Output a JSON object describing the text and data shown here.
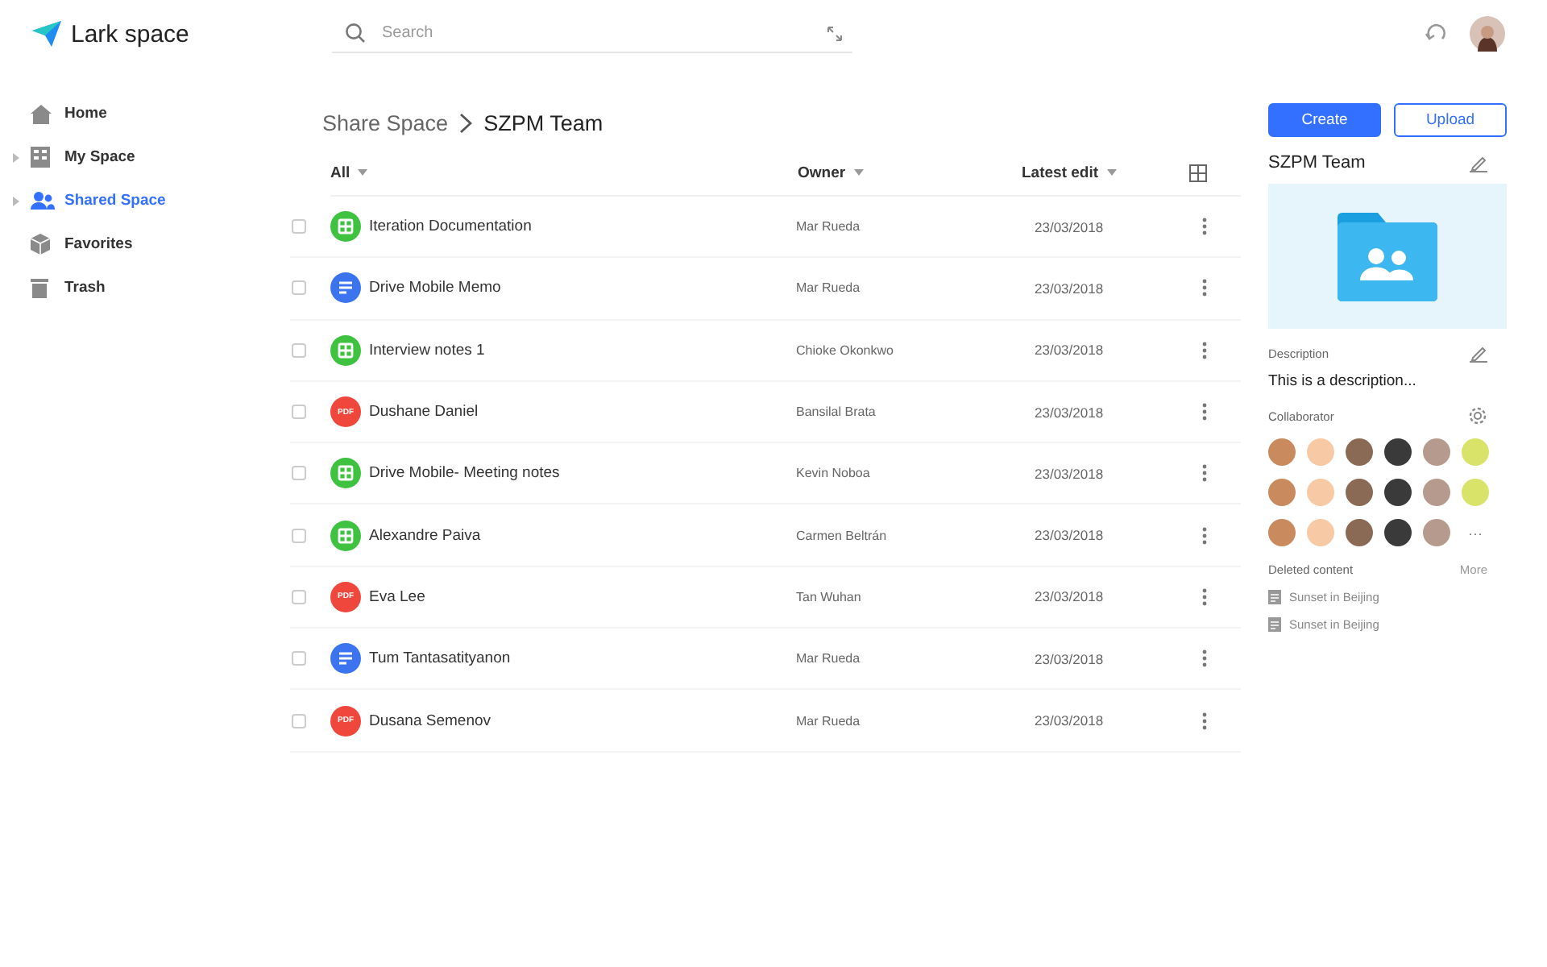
{
  "app": {
    "title": "Lark space"
  },
  "search": {
    "placeholder": "Search"
  },
  "sidebar": {
    "items": [
      {
        "label": "Home",
        "kind": "home",
        "collapsible": false,
        "selected": false
      },
      {
        "label": "My Space",
        "kind": "space",
        "collapsible": true,
        "selected": false
      },
      {
        "label": "Shared Space",
        "kind": "team",
        "collapsible": true,
        "selected": true
      },
      {
        "label": "Favorites",
        "kind": "favorites",
        "collapsible": false,
        "selected": false
      },
      {
        "label": "Trash",
        "kind": "trash",
        "collapsible": false,
        "selected": false
      }
    ]
  },
  "breadcrumb": [
    {
      "label": "Share Space",
      "selected": false
    },
    {
      "label": "SZPM Team",
      "selected": true
    }
  ],
  "table": {
    "columns": [
      "All",
      "Owner",
      "Latest edit"
    ],
    "rows": [
      {
        "kind": "sheet",
        "name": "Iteration Documentation",
        "owner": "Mar Rueda",
        "date": "23/03/2018",
        "checked": false
      },
      {
        "kind": "doc",
        "name": "Drive Mobile Memo",
        "owner": "Mar Rueda",
        "date": "23/03/2018",
        "checked": false
      },
      {
        "kind": "sheet",
        "name": "Interview notes 1",
        "owner": "Chioke Okonkwo",
        "date": "23/03/2018",
        "checked": false
      },
      {
        "kind": "pdf",
        "icon_text": "PDF",
        "name": "Dushane Daniel",
        "owner": "Bansilal Brata",
        "date": "23/03/2018",
        "checked": false
      },
      {
        "kind": "sheet",
        "name": "Drive Mobile- Meeting notes",
        "owner": "Kevin Noboa",
        "date": "23/03/2018",
        "checked": false
      },
      {
        "kind": "sheet",
        "name": "Alexandre Paiva",
        "owner": "Carmen Beltrán",
        "date": "23/03/2018",
        "checked": false
      },
      {
        "kind": "pdf",
        "icon_text": "PDF",
        "name": "Eva Lee",
        "owner": "Tan Wuhan",
        "date": "23/03/2018",
        "checked": false
      },
      {
        "kind": "doc",
        "name": "Tum Tantasatityanon",
        "owner": "Mar Rueda",
        "date": "23/03/2018",
        "checked": false
      },
      {
        "kind": "pdf",
        "icon_text": "PDF",
        "name": "Dusana Semenov",
        "owner": "Mar Rueda",
        "date": "23/03/2018",
        "checked": false
      }
    ]
  },
  "buttons": [
    "Create",
    "Upload"
  ],
  "panel": {
    "title": "SZPM Team",
    "description_label": "Description",
    "description": "This is a description...",
    "collaborator_label": "Collaborator",
    "collaborators": [
      {
        "color": "#c98a5e"
      },
      {
        "color": "#f7c9a4"
      },
      {
        "color": "#8a6a55"
      },
      {
        "color": "#3a3a3a"
      },
      {
        "color": "#b79a8e"
      },
      {
        "color": "#d9e36a"
      },
      {
        "color": "#c98a5e"
      },
      {
        "color": "#f7c9a4"
      },
      {
        "color": "#8a6a55"
      },
      {
        "color": "#3a3a3a"
      },
      {
        "color": "#b79a8e"
      },
      {
        "color": "#d9e36a"
      },
      {
        "color": "#c98a5e"
      },
      {
        "color": "#f7c9a4"
      },
      {
        "color": "#8a6a55"
      },
      {
        "color": "#3a3a3a"
      },
      {
        "color": "#b79a8e"
      }
    ],
    "more_collaborators": "···",
    "deleted_label": "Deleted content",
    "more_link": "More",
    "deleted": [
      "Sunset in Beijing",
      "Sunset in Beijing"
    ]
  }
}
